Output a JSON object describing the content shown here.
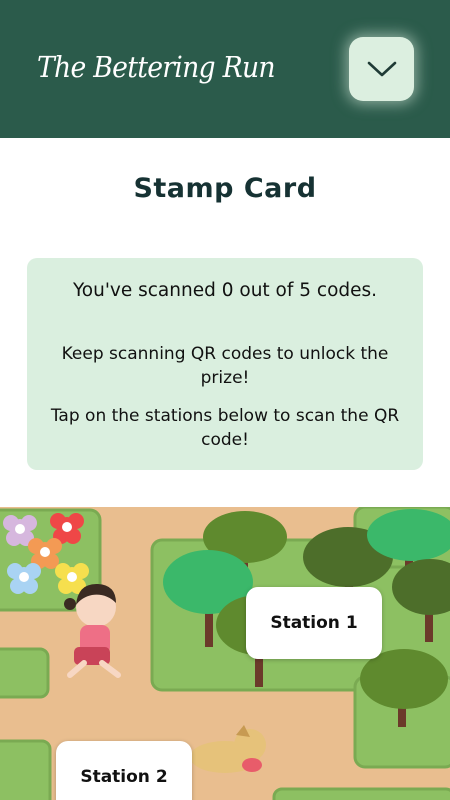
{
  "header": {
    "brand": "The Bettering Run",
    "menu_icon": "chevron-down-icon",
    "bg_color": "#2b5b4b"
  },
  "main": {
    "title": "Stamp Card",
    "info": {
      "scanned_text": "You've scanned 0 out of 5 codes.",
      "keep_text": "Keep scanning QR codes to unlock the prize!",
      "tap_text": "Tap on the stations below to scan the QR code!"
    }
  },
  "map": {
    "stations": [
      {
        "label": "Station 1"
      },
      {
        "label": "Station 2"
      }
    ],
    "illustrations": [
      "flower-bed",
      "running-girl",
      "tree-cluster",
      "running-dog"
    ]
  }
}
